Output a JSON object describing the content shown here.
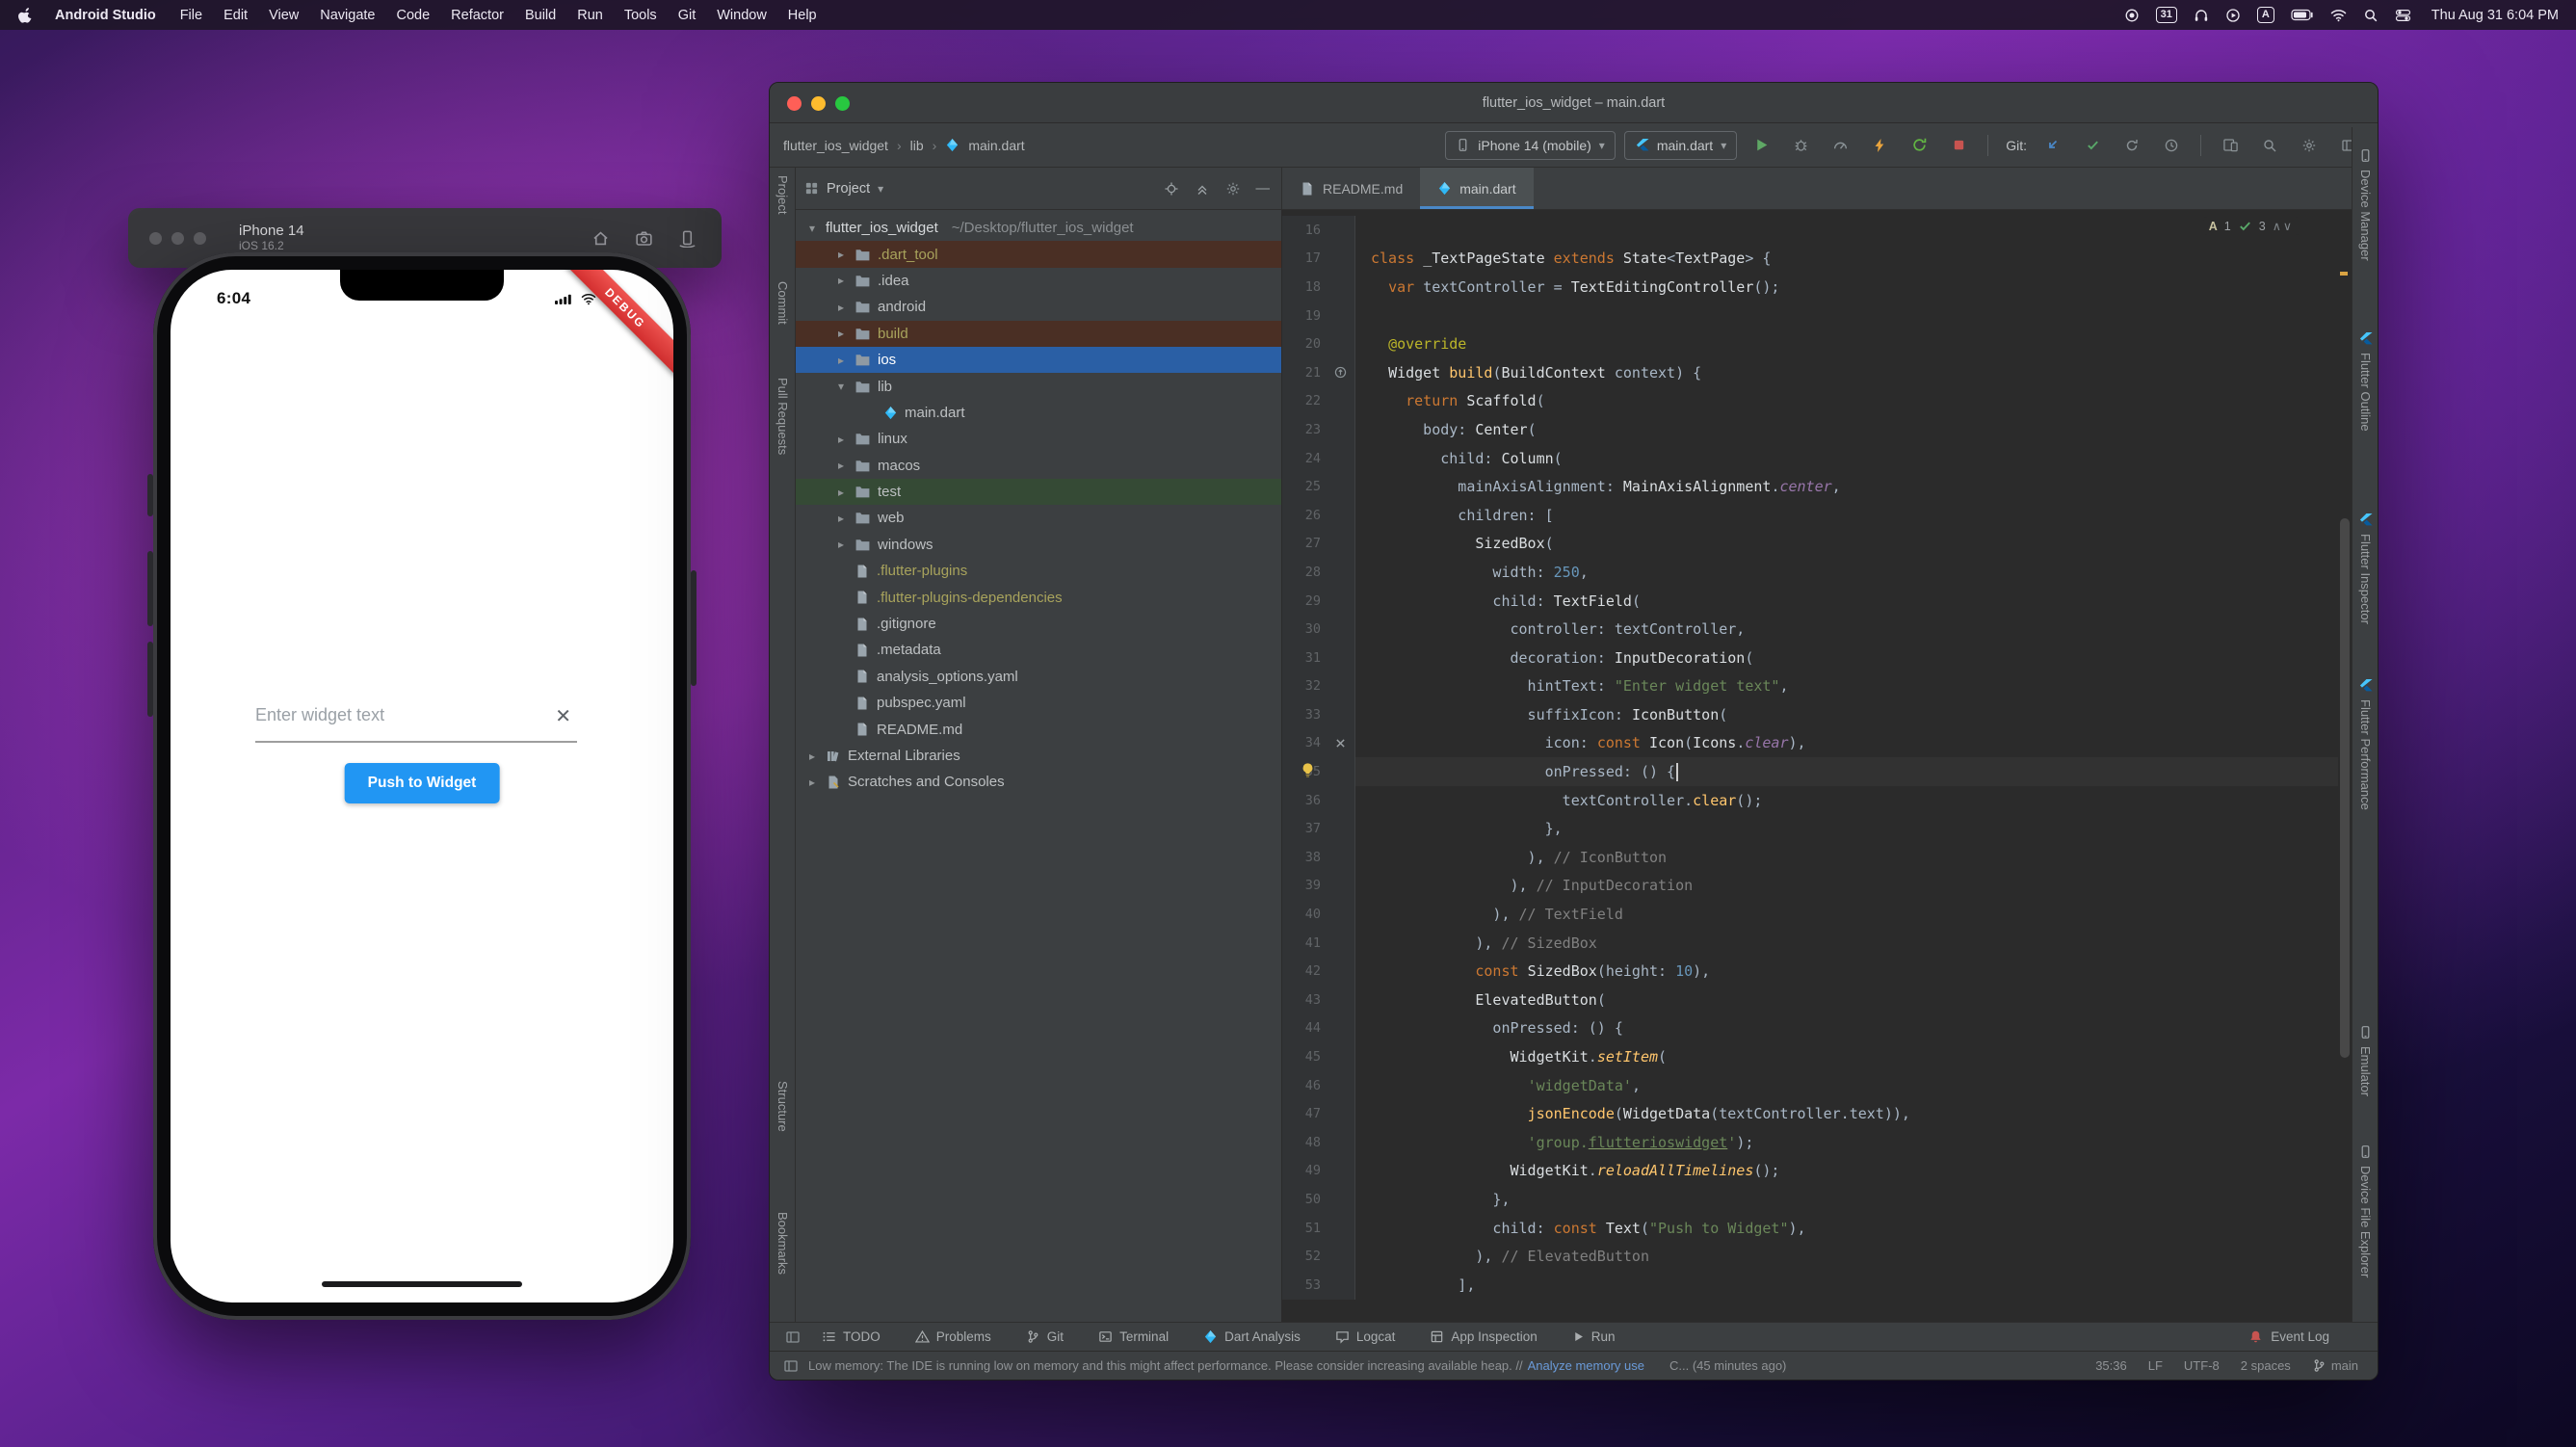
{
  "menubar": {
    "app_name": "Android Studio",
    "items": [
      "File",
      "Edit",
      "View",
      "Navigate",
      "Code",
      "Refactor",
      "Build",
      "Run",
      "Tools",
      "Git",
      "Window",
      "Help"
    ],
    "status": {
      "calendar_day": "31",
      "keyboard_layout": "A",
      "clock": "Thu Aug 31 6:04 PM"
    }
  },
  "simulator": {
    "title": "iPhone 14",
    "subtitle": "iOS 16.2",
    "status_time": "6:04",
    "debug_banner": "DEBUG",
    "app": {
      "hint_text": "Enter widget text",
      "clear_glyph": "✕",
      "button_label": "Push to Widget",
      "accent": "#2196F3"
    }
  },
  "studio": {
    "window_title": "flutter_ios_widget – main.dart",
    "breadcrumbs": [
      "flutter_ios_widget",
      "lib",
      "main.dart"
    ],
    "crumb_sep": "›",
    "device_selector": "iPhone 14 (mobile)",
    "run_config": "main.dart",
    "git_label": "Git:",
    "project_header": "Project",
    "tabs": [
      {
        "label": "README.md",
        "icon": "file",
        "active": false
      },
      {
        "label": "main.dart",
        "icon": "dart",
        "active": true
      }
    ],
    "left_stripe": [
      "Project",
      "Commit",
      "Pull Requests",
      "Structure",
      "Bookmarks"
    ],
    "right_stripe": [
      {
        "label": "Device Manager",
        "icon": "phone-sm"
      },
      {
        "label": "Flutter Outline",
        "icon": "flutter"
      },
      {
        "label": "Flutter Inspector",
        "icon": "flutter"
      },
      {
        "label": "Flutter Performance",
        "icon": "flutter"
      },
      {
        "label": "Emulator",
        "icon": "phone-sm"
      },
      {
        "label": "Device File Explorer",
        "icon": "phone-sm"
      }
    ],
    "inspection": {
      "letter": "A",
      "warnings": "1",
      "passed": "3"
    }
  },
  "project": {
    "tree": [
      {
        "label": "flutter_ios_widget",
        "hint": "~/Desktop/flutter_ios_widget",
        "depth": 0,
        "kind": "project",
        "chevron": "open"
      },
      {
        "label": ".dart_tool",
        "depth": 1,
        "kind": "folder",
        "chevron": "closed",
        "hl": "excluded",
        "fg": "ignored"
      },
      {
        "label": ".idea",
        "depth": 1,
        "kind": "folder",
        "chevron": "closed"
      },
      {
        "label": "android",
        "depth": 1,
        "kind": "folder",
        "chevron": "closed"
      },
      {
        "label": "build",
        "depth": 1,
        "kind": "folder",
        "chevron": "closed",
        "hl": "excluded",
        "fg": "ignored"
      },
      {
        "label": "ios",
        "depth": 1,
        "kind": "folder",
        "chevron": "closed",
        "hl": "selected"
      },
      {
        "label": "lib",
        "depth": 1,
        "kind": "folder",
        "chevron": "open"
      },
      {
        "label": "main.dart",
        "depth": 2,
        "kind": "dart"
      },
      {
        "label": "linux",
        "depth": 1,
        "kind": "folder",
        "chevron": "closed"
      },
      {
        "label": "macos",
        "depth": 1,
        "kind": "folder",
        "chevron": "closed"
      },
      {
        "label": "test",
        "depth": 1,
        "kind": "folder",
        "chevron": "closed",
        "hl": "test"
      },
      {
        "label": "web",
        "depth": 1,
        "kind": "folder",
        "chevron": "closed"
      },
      {
        "label": "windows",
        "depth": 1,
        "kind": "folder",
        "chevron": "closed"
      },
      {
        "label": ".flutter-plugins",
        "depth": 1,
        "kind": "file",
        "fg": "ignored"
      },
      {
        "label": ".flutter-plugins-dependencies",
        "depth": 1,
        "kind": "file",
        "fg": "ignored"
      },
      {
        "label": ".gitignore",
        "depth": 1,
        "kind": "file"
      },
      {
        "label": ".metadata",
        "depth": 1,
        "kind": "file"
      },
      {
        "label": "analysis_options.yaml",
        "depth": 1,
        "kind": "file"
      },
      {
        "label": "pubspec.yaml",
        "depth": 1,
        "kind": "file"
      },
      {
        "label": "README.md",
        "depth": 1,
        "kind": "file"
      },
      {
        "label": "External Libraries",
        "depth": 0,
        "kind": "lib",
        "chevron": "closed"
      },
      {
        "label": "Scratches and Consoles",
        "depth": 0,
        "kind": "scratch",
        "chevron": "closed"
      }
    ]
  },
  "editor": {
    "caret_line": 35,
    "bulb_line": 35,
    "gutter_markers": {
      "21": "override",
      "34": "close"
    },
    "lines": [
      {
        "n": 16,
        "s": []
      },
      {
        "n": 17,
        "s": [
          [
            "k",
            "class "
          ],
          [
            "t",
            "_TextPageState "
          ],
          [
            "k",
            "extends "
          ],
          [
            "t",
            "State"
          ],
          [
            "d",
            "<"
          ],
          [
            "t",
            "TextPage"
          ],
          [
            "d",
            "> {"
          ]
        ]
      },
      {
        "n": 18,
        "s": [
          [
            "d",
            "  "
          ],
          [
            "k",
            "var "
          ],
          [
            "d",
            "textController = "
          ],
          [
            "t",
            "TextEditingController"
          ],
          [
            "d",
            "();"
          ]
        ]
      },
      {
        "n": 19,
        "s": []
      },
      {
        "n": 20,
        "s": [
          [
            "d",
            "  "
          ],
          [
            "an",
            "@override"
          ]
        ]
      },
      {
        "n": 21,
        "s": [
          [
            "d",
            "  "
          ],
          [
            "t",
            "Widget "
          ],
          [
            "fn",
            "build"
          ],
          [
            "d",
            "("
          ],
          [
            "t",
            "BuildContext "
          ],
          [
            "d",
            "context) {"
          ]
        ]
      },
      {
        "n": 22,
        "s": [
          [
            "d",
            "    "
          ],
          [
            "k",
            "return "
          ],
          [
            "t",
            "Scaffold"
          ],
          [
            "d",
            "("
          ]
        ]
      },
      {
        "n": 23,
        "s": [
          [
            "d",
            "      body: "
          ],
          [
            "t",
            "Center"
          ],
          [
            "d",
            "("
          ]
        ]
      },
      {
        "n": 24,
        "s": [
          [
            "d",
            "        child: "
          ],
          [
            "t",
            "Column"
          ],
          [
            "d",
            "("
          ]
        ]
      },
      {
        "n": 25,
        "s": [
          [
            "d",
            "          mainAxisAlignment: "
          ],
          [
            "t",
            "MainAxisAlignment"
          ],
          [
            "d",
            "."
          ],
          [
            "fl",
            "center"
          ],
          [
            "d",
            ","
          ]
        ]
      },
      {
        "n": 26,
        "s": [
          [
            "d",
            "          children: ["
          ]
        ]
      },
      {
        "n": 27,
        "s": [
          [
            "d",
            "            "
          ],
          [
            "t",
            "SizedBox"
          ],
          [
            "d",
            "("
          ]
        ]
      },
      {
        "n": 28,
        "s": [
          [
            "d",
            "              width: "
          ],
          [
            "n",
            "250"
          ],
          [
            "d",
            ","
          ]
        ]
      },
      {
        "n": 29,
        "s": [
          [
            "d",
            "              child: "
          ],
          [
            "t",
            "TextField"
          ],
          [
            "d",
            "("
          ]
        ]
      },
      {
        "n": 30,
        "s": [
          [
            "d",
            "                controller: textController,"
          ]
        ]
      },
      {
        "n": 31,
        "s": [
          [
            "d",
            "                decoration: "
          ],
          [
            "t",
            "InputDecoration"
          ],
          [
            "d",
            "("
          ]
        ]
      },
      {
        "n": 32,
        "s": [
          [
            "d",
            "                  hintText: "
          ],
          [
            "s",
            "\"Enter widget text\""
          ],
          [
            "d",
            ","
          ]
        ]
      },
      {
        "n": 33,
        "s": [
          [
            "d",
            "                  suffixIcon: "
          ],
          [
            "t",
            "IconButton"
          ],
          [
            "d",
            "("
          ]
        ]
      },
      {
        "n": 34,
        "s": [
          [
            "d",
            "                    icon: "
          ],
          [
            "k",
            "const "
          ],
          [
            "t",
            "Icon"
          ],
          [
            "d",
            "("
          ],
          [
            "t",
            "Icons"
          ],
          [
            "d",
            "."
          ],
          [
            "fl",
            "clear"
          ],
          [
            "d",
            "),"
          ]
        ]
      },
      {
        "n": 35,
        "s": [
          [
            "d",
            "                    onPressed: () {"
          ]
        ]
      },
      {
        "n": 36,
        "s": [
          [
            "d",
            "                      textController."
          ],
          [
            "fn",
            "clear"
          ],
          [
            "d",
            "();"
          ]
        ]
      },
      {
        "n": 37,
        "s": [
          [
            "d",
            "                    },"
          ]
        ]
      },
      {
        "n": 38,
        "s": [
          [
            "d",
            "                  ), "
          ],
          [
            "cm",
            "// IconButton"
          ]
        ]
      },
      {
        "n": 39,
        "s": [
          [
            "d",
            "                ), "
          ],
          [
            "cm",
            "// InputDecoration"
          ]
        ]
      },
      {
        "n": 40,
        "s": [
          [
            "d",
            "              ), "
          ],
          [
            "cm",
            "// TextField"
          ]
        ]
      },
      {
        "n": 41,
        "s": [
          [
            "d",
            "            ), "
          ],
          [
            "cm",
            "// SizedBox"
          ]
        ]
      },
      {
        "n": 42,
        "s": [
          [
            "d",
            "            "
          ],
          [
            "k",
            "const "
          ],
          [
            "t",
            "SizedBox"
          ],
          [
            "d",
            "(height: "
          ],
          [
            "n",
            "10"
          ],
          [
            "d",
            "),"
          ]
        ]
      },
      {
        "n": 43,
        "s": [
          [
            "d",
            "            "
          ],
          [
            "t",
            "ElevatedButton"
          ],
          [
            "d",
            "("
          ]
        ]
      },
      {
        "n": 44,
        "s": [
          [
            "d",
            "              onPressed: () {"
          ]
        ]
      },
      {
        "n": 45,
        "s": [
          [
            "d",
            "                "
          ],
          [
            "t",
            "WidgetKit"
          ],
          [
            "d",
            "."
          ],
          [
            "fi",
            "setItem"
          ],
          [
            "d",
            "("
          ]
        ]
      },
      {
        "n": 46,
        "s": [
          [
            "d",
            "                  "
          ],
          [
            "s",
            "'widgetData'"
          ],
          [
            "d",
            ","
          ]
        ]
      },
      {
        "n": 47,
        "s": [
          [
            "d",
            "                  "
          ],
          [
            "fn",
            "jsonEncode"
          ],
          [
            "d",
            "("
          ],
          [
            "t",
            "WidgetData"
          ],
          [
            "d",
            "(textController.text)),"
          ]
        ]
      },
      {
        "n": 48,
        "s": [
          [
            "d",
            "                  "
          ],
          [
            "s",
            "'group."
          ],
          [
            "su",
            "flutterioswidget"
          ],
          [
            "s",
            "'"
          ],
          [
            "d",
            ");"
          ]
        ]
      },
      {
        "n": 49,
        "s": [
          [
            "d",
            "                "
          ],
          [
            "t",
            "WidgetKit"
          ],
          [
            "d",
            "."
          ],
          [
            "fi",
            "reloadAllTimelines"
          ],
          [
            "d",
            "();"
          ]
        ]
      },
      {
        "n": 50,
        "s": [
          [
            "d",
            "              },"
          ]
        ]
      },
      {
        "n": 51,
        "s": [
          [
            "d",
            "              child: "
          ],
          [
            "k",
            "const "
          ],
          [
            "t",
            "Text"
          ],
          [
            "d",
            "("
          ],
          [
            "s",
            "\"Push to Widget\""
          ],
          [
            "d",
            "),"
          ]
        ]
      },
      {
        "n": 52,
        "s": [
          [
            "d",
            "            ), "
          ],
          [
            "cm",
            "// ElevatedButton"
          ]
        ]
      },
      {
        "n": 53,
        "s": [
          [
            "d",
            "          ],"
          ]
        ]
      }
    ]
  },
  "bottombar": {
    "left": [
      {
        "label": "TODO",
        "icon": "list"
      },
      {
        "label": "Problems",
        "icon": "warn"
      },
      {
        "label": "Git",
        "icon": "gitb"
      },
      {
        "label": "Terminal",
        "icon": "terminal"
      },
      {
        "label": "Dart Analysis",
        "icon": "dart"
      },
      {
        "label": "Logcat",
        "icon": "logcat"
      },
      {
        "label": "App Inspection",
        "icon": "inspect"
      },
      {
        "label": "Run",
        "icon": "playsm"
      }
    ],
    "event_log": "Event Log"
  },
  "statusbar": {
    "message": "Low memory: The IDE is running low on memory and this might affect performance. Please consider increasing available heap. //",
    "link": "Analyze memory use",
    "commit_info": "C... (45 minutes ago)",
    "caret": "35:36",
    "line_ending": "LF",
    "encoding": "UTF-8",
    "indent": "2 spaces",
    "branch": "main"
  }
}
